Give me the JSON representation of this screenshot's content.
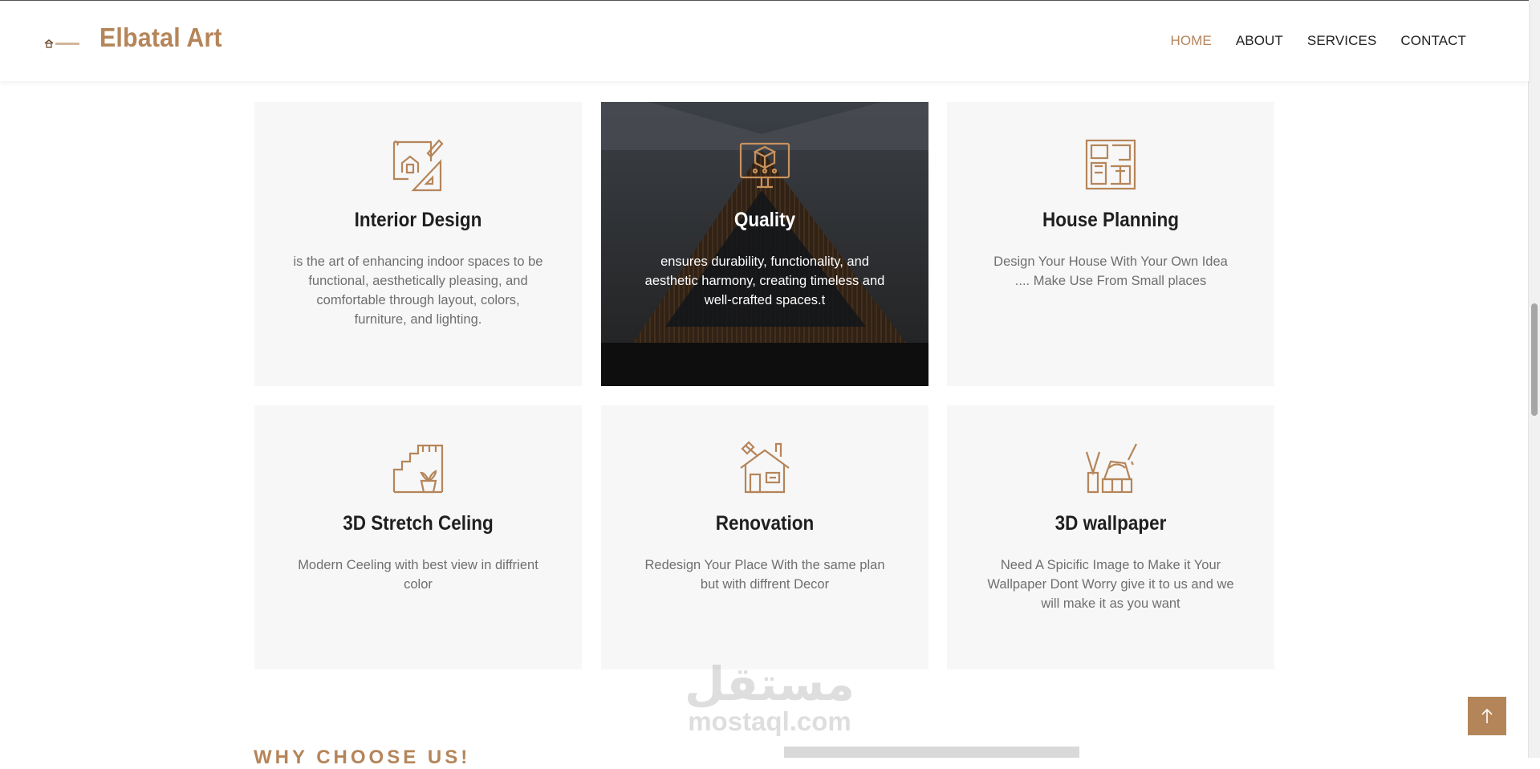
{
  "header": {
    "logo_text": "ELBATAL ART",
    "brand": "Elbatal Art",
    "nav": [
      {
        "label": "HOME",
        "active": true
      },
      {
        "label": "ABOUT",
        "active": false
      },
      {
        "label": "SERVICES",
        "active": false
      },
      {
        "label": "CONTACT",
        "active": false
      }
    ]
  },
  "services": [
    {
      "icon": "blueprint-house-icon",
      "title": "Interior Design",
      "desc": "is the art of enhancing indoor spaces to be functional, aesthetically pleasing, and comfortable through layout, colors, furniture, and lighting."
    },
    {
      "icon": "3d-monitor-icon",
      "title": "Quality",
      "desc": "ensures durability, functionality, and aesthetic harmony, creating timeless and well-crafted spaces.t"
    },
    {
      "icon": "floor-plan-icon",
      "title": "House Planning",
      "desc": "Design Your House With Your Own Idea .... Make Use From Small places"
    },
    {
      "icon": "stairs-plant-icon",
      "title": "3D Stretch Celing",
      "desc": "Modern Ceeling with best view in diffrient color"
    },
    {
      "icon": "house-renovation-icon",
      "title": "Renovation",
      "desc": "Redesign Your Place With the same plan but with diffrent Decor"
    },
    {
      "icon": "paint-tools-icon",
      "title": "3D wallpaper",
      "desc": "Need A Spicific Image to Make it Your Wallpaper Dont Worry give it to us and we will make it as you want"
    }
  ],
  "section_heading": "WHY CHOOSE US!",
  "watermark": {
    "arabic": "مستقل",
    "latin": "mostaql.com"
  },
  "colors": {
    "accent": "#b5855a",
    "card_bg": "#f7f7f7",
    "text_muted": "#6f6f6f"
  }
}
